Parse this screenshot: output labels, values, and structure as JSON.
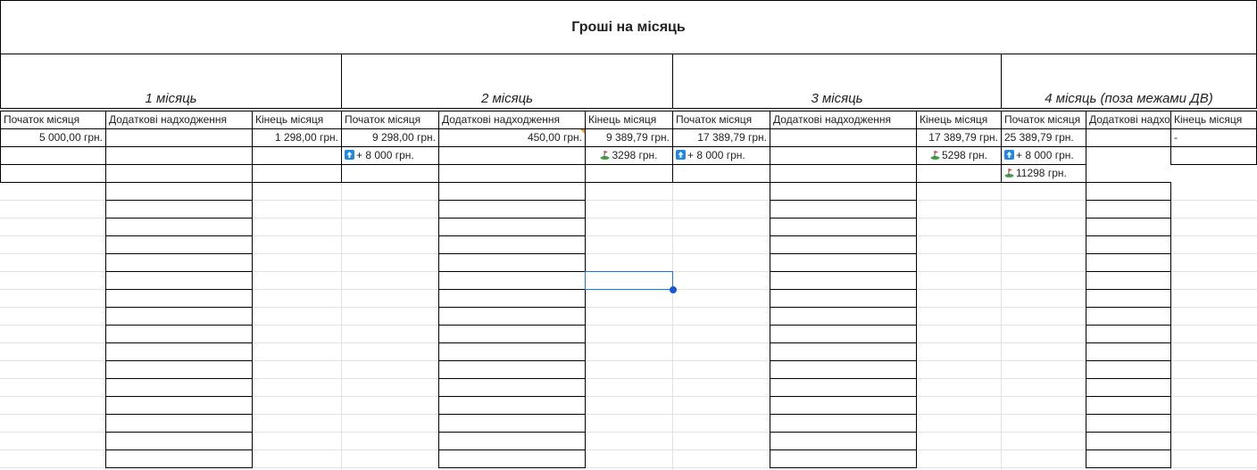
{
  "title": "Гроші на місяць",
  "months": [
    "1 місяць",
    "2 місяць",
    "3 місяць",
    "4 місяць (поза межами ДВ)"
  ],
  "headers": {
    "start": "Початок місяця",
    "extra": "Додаткові надходження",
    "end": "Кінець місяця"
  },
  "month1": {
    "start": "5 000,00 грн.",
    "end": "1 298,00 грн."
  },
  "month2": {
    "start": "9 298,00 грн.",
    "extra": "450,00 грн.",
    "end": "9 389,79 грн.",
    "deposit": "+ 8 000 грн.",
    "goal": "3298 грн."
  },
  "month3": {
    "start": "17 389,79 грн.",
    "end": "17 389,79 грн.",
    "deposit": "+ 8 000 грн.",
    "goal": "5298 грн."
  },
  "month4": {
    "start": "25 389,79 грн.",
    "end": "-",
    "deposit": "+ 8 000 грн.",
    "goal": "11298 грн."
  },
  "icons": {
    "deposit": "up-arrow-icon",
    "goal": "golf-flag-icon"
  },
  "colors": {
    "selection": "#1a73e8",
    "arrow_bg": "#1e88e5",
    "comment": "#f29900"
  }
}
